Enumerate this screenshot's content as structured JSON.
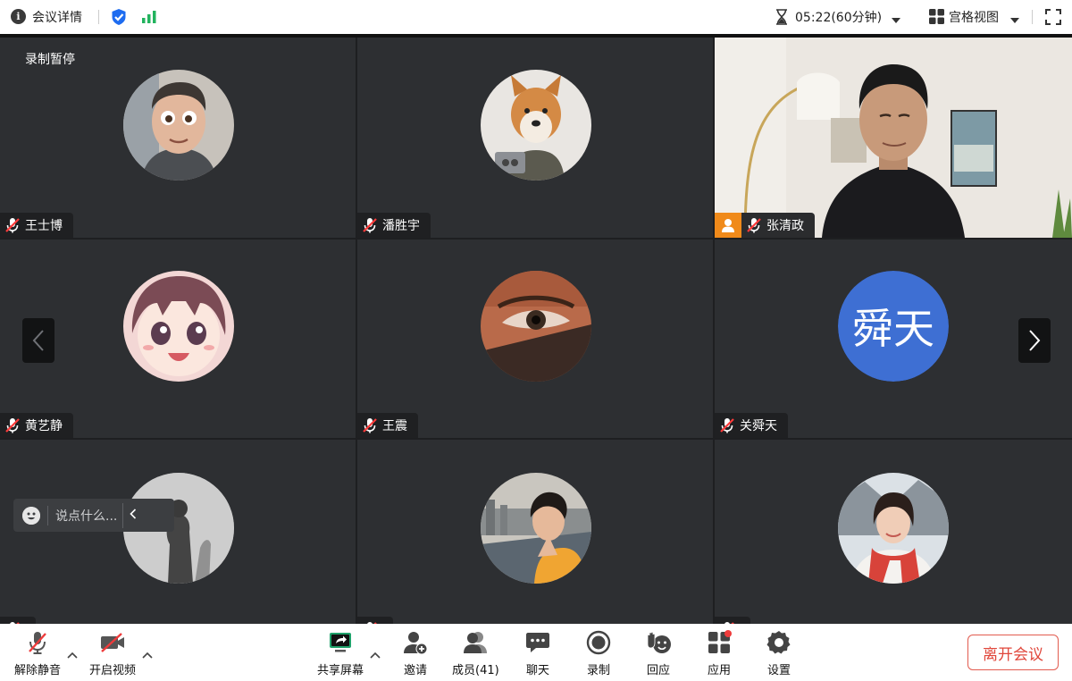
{
  "topbar": {
    "meeting_details": "会议详情",
    "timer": "05:22(60分钟)",
    "view_mode": "宫格视图"
  },
  "grid": {
    "recording_status": "录制暂停",
    "tiles": [
      {
        "name": "王士博",
        "avatar": "cartoon-man-avatar"
      },
      {
        "name": "潘胜宇",
        "avatar": "shiba-dog-avatar"
      },
      {
        "name": "张清政",
        "avatar": "live-video"
      },
      {
        "name": "黄艺静",
        "avatar": "anime-girl-avatar"
      },
      {
        "name": "王震",
        "avatar": "eye-closeup-avatar"
      },
      {
        "name": "关舜天",
        "avatar_text": "舜天",
        "avatar_color": "#3e6fd3"
      },
      {
        "name": "",
        "avatar": "shadow-wall-avatar"
      },
      {
        "name": "",
        "avatar": "boy-balcony-avatar"
      },
      {
        "name": "",
        "avatar": "girl-scarf-avatar"
      }
    ],
    "chat_placeholder": "说点什么..."
  },
  "toolbar": {
    "unmute": "解除静音",
    "start_video": "开启视频",
    "share_screen": "共享屏幕",
    "invite": "邀请",
    "members": "成员(41)",
    "chat": "聊天",
    "record": "录制",
    "react": "回应",
    "apps": "应用",
    "settings": "设置",
    "leave": "离开会议"
  },
  "colors": {
    "tile_bg": "#2d2f32",
    "leave_red": "#e0463a",
    "signal_green": "#22b35e",
    "shield_blue": "#1e6cf0",
    "host_orange": "#f08a1a",
    "share_green": "#1fa16a"
  }
}
